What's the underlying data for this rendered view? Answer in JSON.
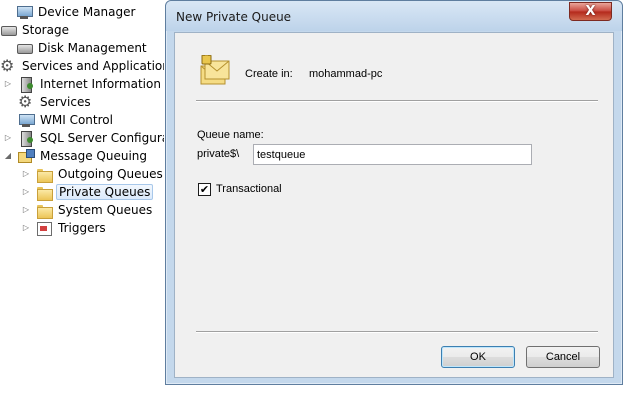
{
  "tree": {
    "items": [
      {
        "label": "Device Manager",
        "icon": "device-manager-icon",
        "expander": ""
      },
      {
        "label": "Storage",
        "icon": "storage-icon",
        "expander": ""
      },
      {
        "label": "Disk Management",
        "icon": "disk-icon",
        "expander": ""
      },
      {
        "label": "Services and Applications",
        "icon": "services-applications-icon",
        "expander": ""
      },
      {
        "label": "Internet Information Ser",
        "icon": "iis-icon",
        "expander": "collapsed"
      },
      {
        "label": "Services",
        "icon": "gear-icon",
        "expander": ""
      },
      {
        "label": "WMI Control",
        "icon": "wmi-icon",
        "expander": ""
      },
      {
        "label": "SQL Server Configuratio",
        "icon": "sql-server-icon",
        "expander": "collapsed"
      },
      {
        "label": "Message Queuing",
        "icon": "message-queuing-icon",
        "expander": "expanded"
      },
      {
        "label": "Outgoing Queues",
        "icon": "folder-icon",
        "expander": "collapsed"
      },
      {
        "label": "Private Queues",
        "icon": "folder-icon",
        "expander": "collapsed",
        "selected": true
      },
      {
        "label": "System Queues",
        "icon": "folder-icon",
        "expander": "collapsed"
      },
      {
        "label": "Triggers",
        "icon": "trigger-icon",
        "expander": "collapsed"
      }
    ]
  },
  "dialog": {
    "title": "New Private Queue",
    "close_label": "X",
    "create_in_label": "Create in:",
    "create_in_value": "mohammad-pc",
    "queue_name_label": "Queue name:",
    "queue_prefix": "private$\\",
    "queue_name_value": "testqueue",
    "transactional_label": "Transactional",
    "transactional_checked": true,
    "check_mark": "✔",
    "ok_label": "OK",
    "cancel_label": "Cancel"
  }
}
